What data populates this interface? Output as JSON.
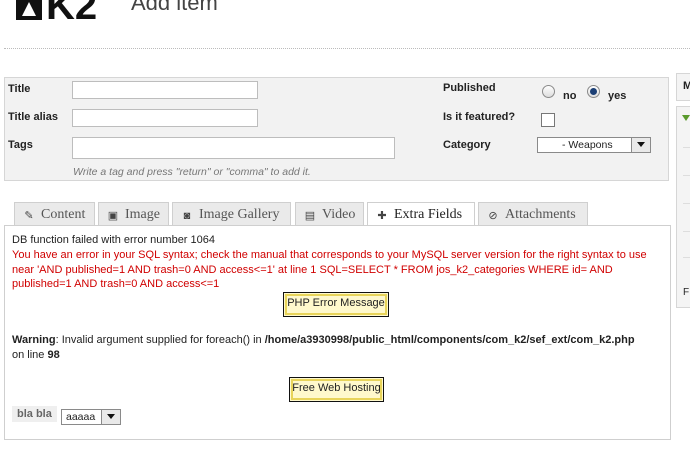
{
  "header": {
    "logo_text": "K2",
    "title": "Add item"
  },
  "form": {
    "title_label": "Title",
    "alias_label": "Title alias",
    "tags_label": "Tags",
    "tags_hint": "Write a tag and press \"return\" or \"comma\" to add it.",
    "published_label": "Published",
    "published_options": [
      "no",
      "yes"
    ],
    "published_value": "yes",
    "featured_label": "Is it featured?",
    "featured_checked": false,
    "category_label": "Category",
    "category_value": "- Weapons"
  },
  "sidebar": {
    "header_letter": "M",
    "footer_letter": "F"
  },
  "tabs": [
    {
      "label": "Content",
      "icon": "pencil-icon"
    },
    {
      "label": "Image",
      "icon": "image-icon"
    },
    {
      "label": "Image Gallery",
      "icon": "camera-icon"
    },
    {
      "label": "Video",
      "icon": "film-icon"
    },
    {
      "label": "Extra Fields",
      "icon": "puzzle-icon",
      "active": true
    },
    {
      "label": "Attachments",
      "icon": "paperclip-icon"
    }
  ],
  "content": {
    "db_error": "DB function failed with error number 1064",
    "sql_error": "You have an error in your SQL syntax; check the manual that corresponds to your MySQL server version for the right syntax to use near 'AND published=1 AND trash=0 AND access<=1' at line 1 SQL=SELECT * FROM jos_k2_categories WHERE id= AND published=1 AND trash=0 AND access<=1",
    "php_error_button": "PHP Error Message",
    "warning_label": "Warning",
    "warning_text": ": Invalid argument supplied for foreach() in ",
    "warning_path": "/home/a3930998/public_html/components/com_k2/sef_ext/com_k2.php",
    "warning_line_prefix": "on line ",
    "warning_line": "98",
    "hosting_button": "Free Web Hosting",
    "extra_field_label": "bla bla",
    "extra_field_value": "aaaaa"
  },
  "colors": {
    "error": "#d00000",
    "accent": "#1b3f75"
  }
}
